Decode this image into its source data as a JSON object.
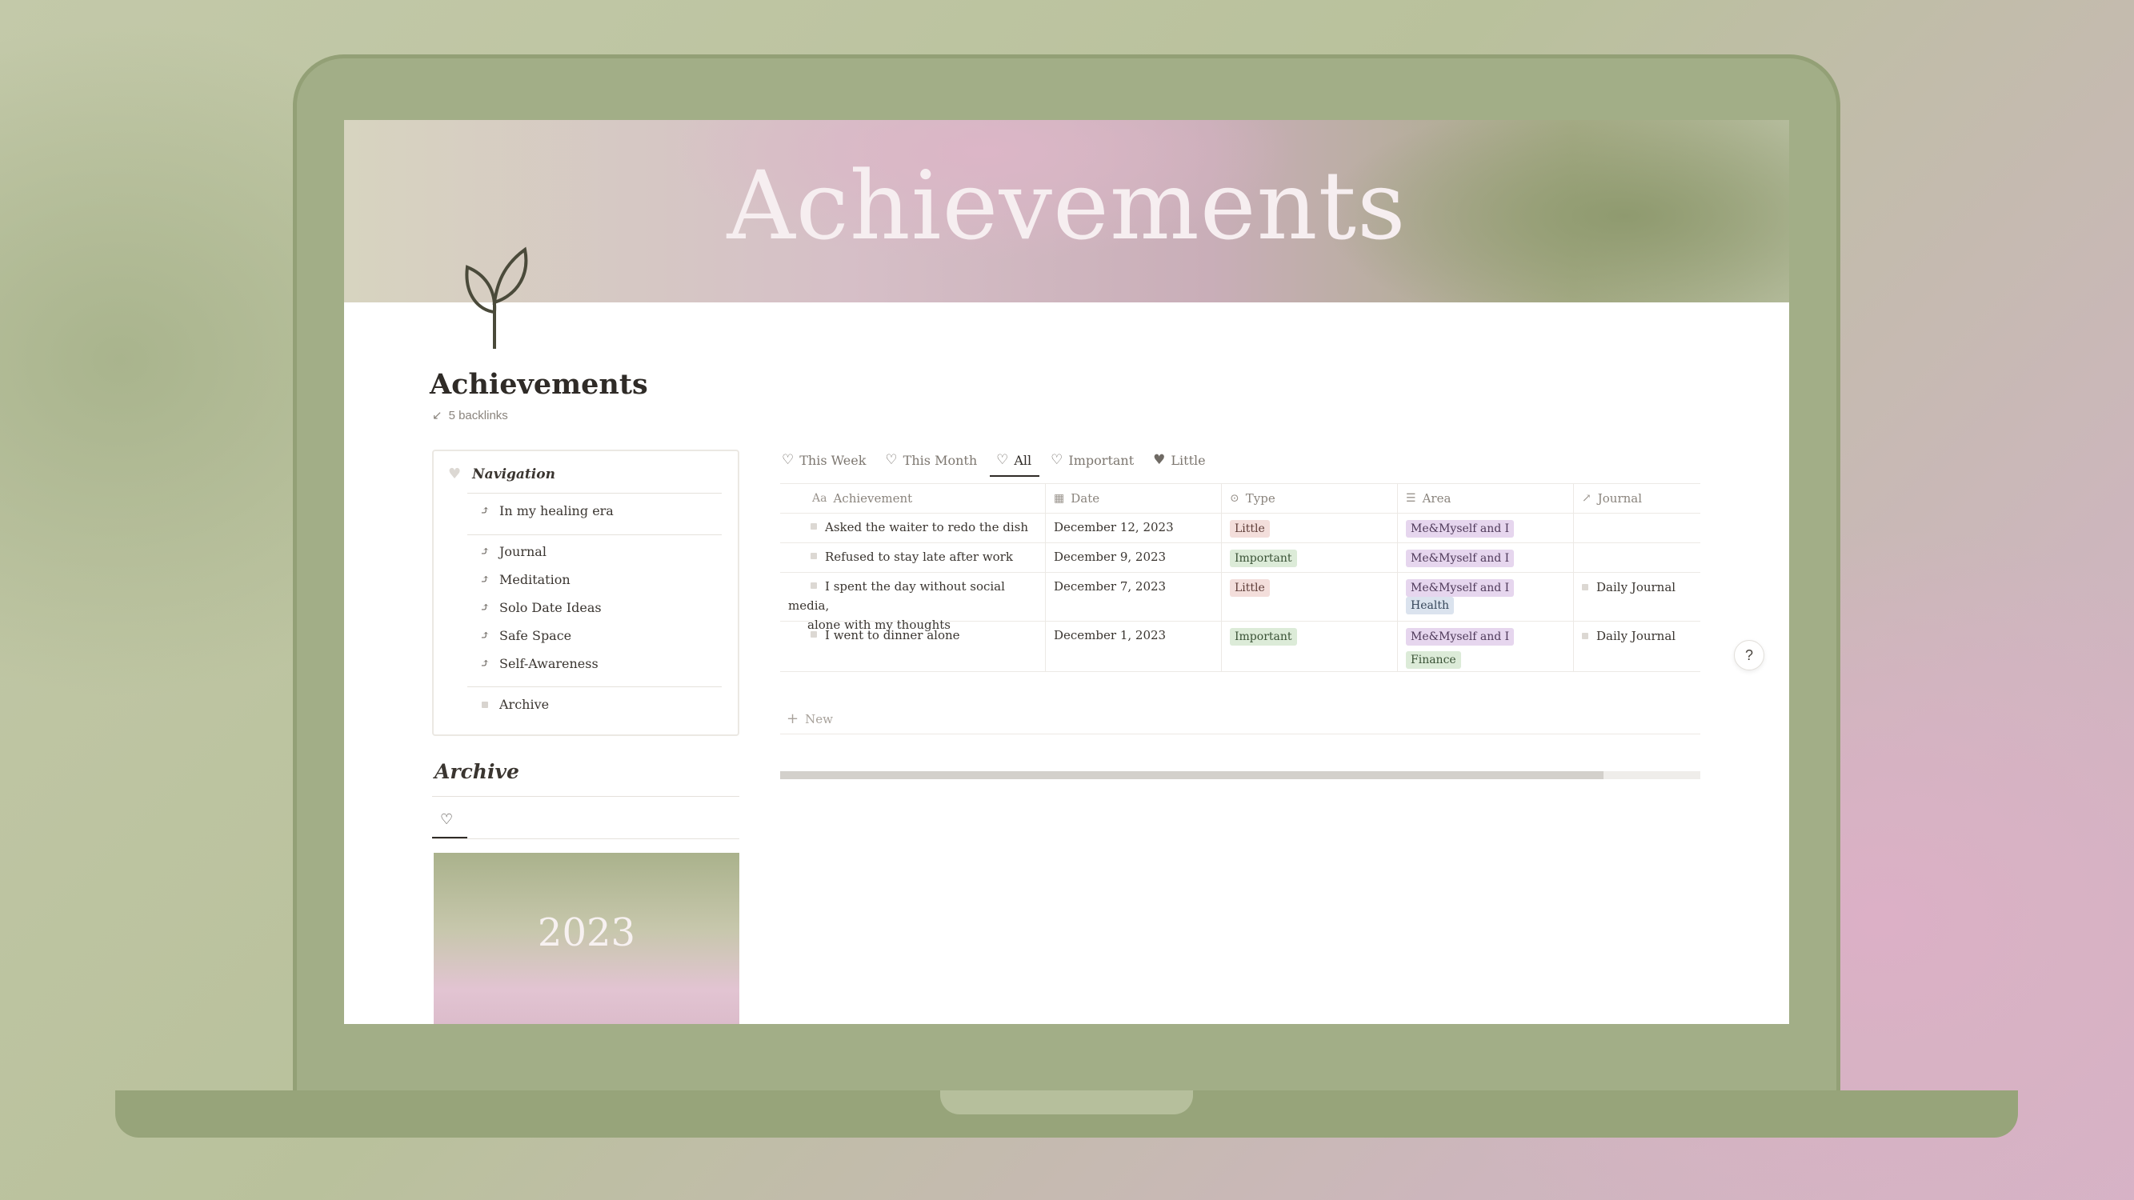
{
  "cover": {
    "title": "Achievements"
  },
  "page": {
    "title": "Achievements",
    "backlinks": "5 backlinks"
  },
  "navigation": {
    "heading": "Navigation",
    "items": [
      {
        "label": "In my healing era",
        "icon": "healing-icon"
      },
      {
        "label": "Journal",
        "icon": "journal-icon"
      },
      {
        "label": "Meditation",
        "icon": "meditation-icon"
      },
      {
        "label": "Solo Date Ideas",
        "icon": "solo-date-icon"
      },
      {
        "label": "Safe Space",
        "icon": "safe-space-icon"
      },
      {
        "label": "Self-Awareness",
        "icon": "self-awareness-icon"
      },
      {
        "label": "Archive",
        "icon": "page-icon"
      }
    ]
  },
  "archive": {
    "title": "Archive",
    "card_year": "2023"
  },
  "views": [
    {
      "label": "This Week",
      "icon": "heart-outline-icon"
    },
    {
      "label": "This Month",
      "icon": "heart-outline-icon"
    },
    {
      "label": "All",
      "icon": "heart-outline-icon",
      "active": true
    },
    {
      "label": "Important",
      "icon": "heart-pulse-icon"
    },
    {
      "label": "Little",
      "icon": "heart-filled-icon"
    }
  ],
  "table": {
    "columns": [
      {
        "label": "Achievement",
        "icon": "text-icon"
      },
      {
        "label": "Date",
        "icon": "calendar-icon"
      },
      {
        "label": "Type",
        "icon": "select-icon"
      },
      {
        "label": "Area",
        "icon": "multi-select-icon"
      },
      {
        "label": "Journal",
        "icon": "relation-arrow-icon"
      }
    ],
    "rows": [
      {
        "achievement": "Asked the waiter to redo the dish",
        "date": "December 12, 2023",
        "type": "Little",
        "area": [
          "Me&Myself and I"
        ],
        "journal": ""
      },
      {
        "achievement": "Refused to stay late after work",
        "date": "December 9, 2023",
        "type": "Important",
        "area": [
          "Me&Myself and I"
        ],
        "journal": ""
      },
      {
        "achievement_line1": "I spent the day without social media,",
        "achievement_line2": "alone with my thoughts",
        "date": "December 7, 2023",
        "type": "Little",
        "area": [
          "Me&Myself and I",
          "Health"
        ],
        "journal": "Daily Journal"
      },
      {
        "achievement": "I went to dinner alone",
        "date": "December 1, 2023",
        "type": "Important",
        "area": [
          "Me&Myself and I",
          "Finance"
        ],
        "journal": "Daily Journal"
      }
    ],
    "new_label": "New"
  },
  "scroll": {
    "thumb_fraction": 0.895
  },
  "help": {
    "label": "?"
  },
  "colors": {
    "laptop": "#a2ae87",
    "tag_little": "#f3dedb",
    "tag_important": "#dcebd8",
    "tag_me": "#e6d6ee",
    "tag_health": "#dbe3ee"
  }
}
